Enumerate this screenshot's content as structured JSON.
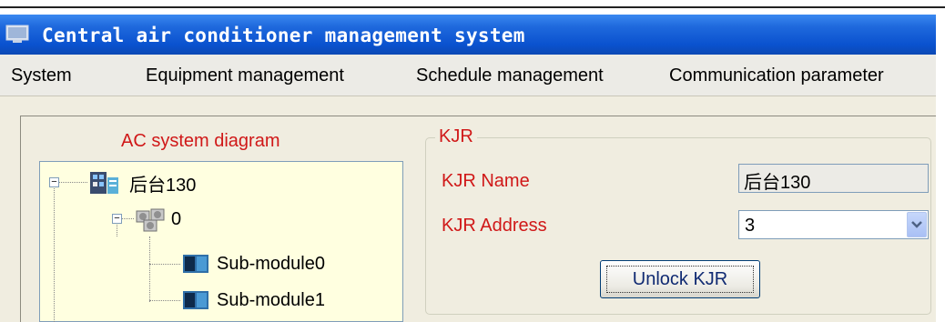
{
  "window": {
    "title": "Central air conditioner management system"
  },
  "menu": [
    "System",
    "Equipment management",
    "Schedule management",
    "Communication parameter"
  ],
  "diagram": {
    "title": "AC system diagram",
    "tree": {
      "root": "后台130",
      "child": "0",
      "leaves": [
        "Sub-module0",
        "Sub-module1"
      ]
    }
  },
  "kjr": {
    "group_title": "KJR",
    "name_label": "KJR Name",
    "name_value": "后台130",
    "address_label": "KJR Address",
    "address_value": "3",
    "unlock_label": "Unlock KJR"
  },
  "colors": {
    "label_red": "#d01818",
    "titlebar_blue": "#0a52cf",
    "tree_bg": "#ffffe0"
  },
  "icons": [
    "app-window-icon",
    "building-icon",
    "ac-units-icon",
    "outdoor-unit-icon",
    "chevron-down-icon"
  ]
}
